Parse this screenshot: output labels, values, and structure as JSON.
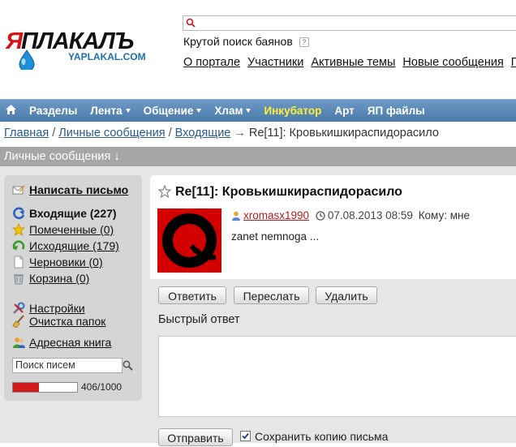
{
  "header": {
    "logo_text": "ЯПЛАКАЛЪ",
    "logo_sub": "YAPLAKAL.COM",
    "search_placeholder": "",
    "search_hint": "Крутой поиск баянов",
    "help_badge": "?",
    "top_links": [
      "О портале",
      "Участники",
      "Активные темы",
      "Новые сообщения",
      "По"
    ]
  },
  "nav": {
    "items": [
      {
        "label": "Разделы",
        "dropdown": false,
        "highlight": false
      },
      {
        "label": "Лента",
        "dropdown": true,
        "highlight": false
      },
      {
        "label": "Общение",
        "dropdown": true,
        "highlight": false
      },
      {
        "label": "Хлам",
        "dropdown": true,
        "highlight": false
      },
      {
        "label": "Инкубатор",
        "dropdown": false,
        "highlight": true
      },
      {
        "label": "Арт",
        "dropdown": false,
        "highlight": false
      },
      {
        "label": "ЯП файлы",
        "dropdown": false,
        "highlight": false
      }
    ],
    "highlight_color": "#ffef3a"
  },
  "breadcrumb": {
    "links": [
      "Главная",
      "Личные сообщения",
      "Входящие"
    ],
    "sep": "/",
    "arrow": "→",
    "current": "Re[11]: Кровькишкираспидорасило"
  },
  "section_title": "Личные сообщения ↓",
  "sidebar": {
    "compose": "Написать письмо",
    "inbox": "Входящие (227)",
    "starred": "Помеченные (0)",
    "sent": "Исходящие (179)",
    "drafts": "Черновики (0)",
    "trash": "Корзина (0)",
    "settings": "Настройки",
    "clean_folders": "Очистка папок",
    "address_book": "Адресная книга",
    "search_placeholder": "Поиск писем",
    "quota_text": "406/1000",
    "quota_fraction": 0.406
  },
  "message": {
    "title": "Re[11]: Кровькишкираспидорасило",
    "author": "xromasx1990",
    "datetime": "07.08.2013 08:59",
    "to_label": "Кому: мне",
    "body": "zanet nemnoga ..."
  },
  "actions": {
    "reply": "Ответить",
    "forward": "Переслать",
    "delete": "Удалить"
  },
  "quick_reply": {
    "label": "Быстрый ответ",
    "send": "Отправить",
    "save_copy": "Сохранить копию письма",
    "save_copy_checked": true
  },
  "colors": {
    "nav_bg": "#5a87b8",
    "section_bar": "#a6a6a6",
    "logo_red": "#d2141a",
    "quota_red": "#cf1a1a",
    "avatar_red": "#d40000"
  }
}
